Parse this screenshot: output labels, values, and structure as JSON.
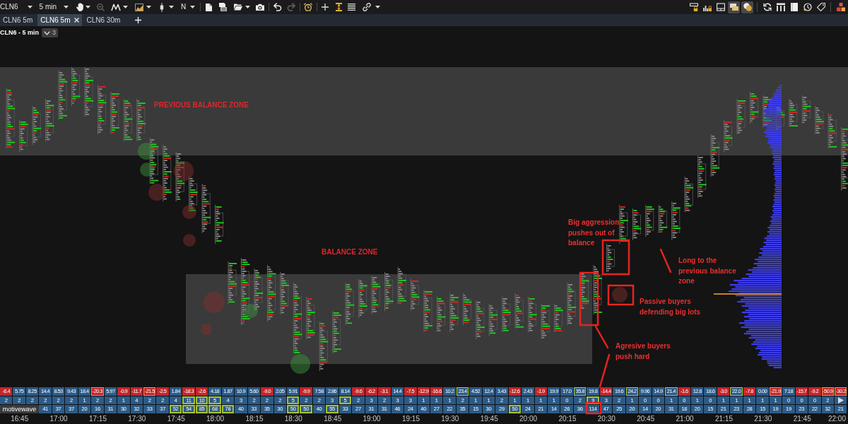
{
  "toolbar": {
    "symbol": "CLN6",
    "interval": "5 min",
    "text_tool": "N",
    "zoom_out": {
      "disabled": true
    },
    "redo": {
      "disabled": true
    },
    "right_buttons": [
      {
        "selected": false
      },
      {
        "selected": false
      },
      {
        "selected": false
      },
      {
        "selected": true
      },
      {
        "selected": true
      },
      {
        "selected": false
      },
      {
        "selected": false
      },
      {
        "selected": false
      },
      {
        "selected": false
      },
      {
        "selected": false
      },
      {
        "selected": false
      }
    ]
  },
  "tabs": [
    {
      "label": "CLN6 5m",
      "selected": false
    },
    {
      "label": "CLN6 5m",
      "selected": true
    },
    {
      "label": "CLN6 30m",
      "selected": false
    }
  ],
  "chart": {
    "title": "CLN6 - 5 min",
    "collapsed_count": "3",
    "zones": [
      {
        "label": "PREVIOUS BALANCE ZONE"
      },
      {
        "label": "BALANCE ZONE"
      }
    ],
    "notes": [
      {
        "text": "Big aggression pushes out of balance"
      },
      {
        "text": "Long to the previous balance zone"
      },
      {
        "text": "Passive buyers defending big lots"
      },
      {
        "text": "Agresive buyers push hard"
      }
    ]
  },
  "stats": {
    "badge": "motivewave",
    "rows": [
      {
        "cells": [
          {
            "text": "-6.4",
            "kind": "sell",
            "highlighted": false
          },
          {
            "text": "5.75",
            "kind": "buy",
            "highlighted": false
          },
          {
            "text": "8.25",
            "kind": "buy",
            "highlighted": false
          },
          {
            "text": "14.4",
            "kind": "buy",
            "highlighted": false
          },
          {
            "text": "8.53",
            "kind": "buy",
            "highlighted": false
          },
          {
            "text": "9.43",
            "kind": "buy",
            "highlighted": false
          },
          {
            "text": "18.4",
            "kind": "buy",
            "highlighted": false
          },
          {
            "text": "-20.3",
            "kind": "sell",
            "highlighted": true
          },
          {
            "text": "5.97",
            "kind": "buy",
            "highlighted": false
          },
          {
            "text": "-0.9",
            "kind": "sell",
            "highlighted": false
          },
          {
            "text": "-11.7",
            "kind": "sell",
            "highlighted": false
          },
          {
            "text": "-21.5",
            "kind": "sell",
            "highlighted": true
          },
          {
            "text": "-2.5",
            "kind": "sell",
            "highlighted": false
          },
          {
            "text": "1.84",
            "kind": "buy",
            "highlighted": false
          },
          {
            "text": "-18.3",
            "kind": "sell",
            "highlighted": false
          },
          {
            "text": "-2.6",
            "kind": "sell",
            "highlighted": false
          },
          {
            "text": "4.18",
            "kind": "buy",
            "highlighted": false
          },
          {
            "text": "1.87",
            "kind": "buy",
            "highlighted": false
          },
          {
            "text": "10.9",
            "kind": "buy",
            "highlighted": false
          },
          {
            "text": "5.60",
            "kind": "buy",
            "highlighted": false
          },
          {
            "text": "-9.0",
            "kind": "sell",
            "highlighted": false
          },
          {
            "text": "2.05",
            "kind": "buy",
            "highlighted": false
          },
          {
            "text": "5.91",
            "kind": "buy",
            "highlighted": false
          },
          {
            "text": "-9.9",
            "kind": "sell",
            "highlighted": false
          },
          {
            "text": "7.58",
            "kind": "buy",
            "highlighted": false
          },
          {
            "text": "2.86",
            "kind": "buy",
            "highlighted": false
          },
          {
            "text": "8.14",
            "kind": "buy",
            "highlighted": false
          },
          {
            "text": "-9.6",
            "kind": "sell",
            "highlighted": false
          },
          {
            "text": "-6.2",
            "kind": "sell",
            "highlighted": false
          },
          {
            "text": "-3.1",
            "kind": "sell",
            "highlighted": false
          },
          {
            "text": "14.4",
            "kind": "buy",
            "highlighted": false
          },
          {
            "text": "-7.5",
            "kind": "sell",
            "highlighted": false
          },
          {
            "text": "-12.9",
            "kind": "sell",
            "highlighted": false
          },
          {
            "text": "-16.6",
            "kind": "sell",
            "highlighted": false
          },
          {
            "text": "10.2",
            "kind": "buy",
            "highlighted": false
          },
          {
            "text": "23.4",
            "kind": "buy",
            "highlighted": true
          },
          {
            "text": "4.52",
            "kind": "buy",
            "highlighted": false
          },
          {
            "text": "12.4",
            "kind": "buy",
            "highlighted": false
          },
          {
            "text": "3.43",
            "kind": "buy",
            "highlighted": false
          },
          {
            "text": "-12.6",
            "kind": "sell",
            "highlighted": false
          },
          {
            "text": "2.43",
            "kind": "buy",
            "highlighted": false
          },
          {
            "text": "-1.9",
            "kind": "sell",
            "highlighted": false
          },
          {
            "text": "19.9",
            "kind": "buy",
            "highlighted": false
          },
          {
            "text": "17.0",
            "kind": "buy",
            "highlighted": false
          },
          {
            "text": "35.8",
            "kind": "buy",
            "highlighted": true
          },
          {
            "text": "19.8",
            "kind": "buy",
            "highlighted": false
          },
          {
            "text": "-14.4",
            "kind": "sell",
            "highlighted": false
          },
          {
            "text": "19.6",
            "kind": "buy",
            "highlighted": false
          },
          {
            "text": "24.2",
            "kind": "buy",
            "highlighted": true
          },
          {
            "text": "9.96",
            "kind": "buy",
            "highlighted": false
          },
          {
            "text": "14.9",
            "kind": "buy",
            "highlighted": false
          },
          {
            "text": "21.4",
            "kind": "buy",
            "highlighted": true
          },
          {
            "text": "-1.6",
            "kind": "sell",
            "highlighted": false
          },
          {
            "text": "12.8",
            "kind": "buy",
            "highlighted": false
          },
          {
            "text": "18.6",
            "kind": "buy",
            "highlighted": false
          },
          {
            "text": "-3.0",
            "kind": "sell",
            "highlighted": false
          },
          {
            "text": "22.0",
            "kind": "buy",
            "highlighted": true
          },
          {
            "text": "-7.8",
            "kind": "sell",
            "highlighted": false
          },
          {
            "text": "0.00",
            "kind": "buy",
            "highlighted": false
          },
          {
            "text": "-21.9",
            "kind": "sell",
            "highlighted": true
          },
          {
            "text": "7.18",
            "kind": "buy",
            "highlighted": false
          },
          {
            "text": "-15.7",
            "kind": "sell",
            "highlighted": false
          },
          {
            "text": "-9.2",
            "kind": "sell",
            "highlighted": false
          },
          {
            "text": "-50.9",
            "kind": "sell",
            "highlighted": true
          },
          {
            "text": "-30.2",
            "kind": "sell",
            "highlighted": true
          }
        ]
      },
      {
        "cells": [
          {
            "text": "2",
            "highlighted": false
          },
          {
            "text": "2",
            "highlighted": false
          },
          {
            "text": "2",
            "highlighted": false
          },
          {
            "text": "2",
            "highlighted": false
          },
          {
            "text": "2",
            "highlighted": false
          },
          {
            "text": "2",
            "highlighted": false
          },
          {
            "text": "1",
            "highlighted": false
          },
          {
            "text": "2",
            "highlighted": false
          },
          {
            "text": "2",
            "highlighted": false
          },
          {
            "text": "1",
            "highlighted": false
          },
          {
            "text": "4",
            "highlighted": false
          },
          {
            "text": "2",
            "highlighted": false
          },
          {
            "text": "2",
            "highlighted": false
          },
          {
            "text": "4",
            "highlighted": false
          },
          {
            "text": "11",
            "highlighted": true
          },
          {
            "text": "10",
            "highlighted": true
          },
          {
            "text": "5",
            "highlighted": true
          },
          {
            "text": "4",
            "highlighted": false
          },
          {
            "text": "3",
            "highlighted": false
          },
          {
            "text": "2",
            "highlighted": false
          },
          {
            "text": "2",
            "highlighted": false
          },
          {
            "text": "2",
            "highlighted": false
          },
          {
            "text": "5",
            "highlighted": true
          },
          {
            "text": "2",
            "highlighted": false
          },
          {
            "text": "2",
            "highlighted": false
          },
          {
            "text": "3",
            "highlighted": false
          },
          {
            "text": "5",
            "highlighted": true
          },
          {
            "text": "2",
            "highlighted": false
          },
          {
            "text": "3",
            "highlighted": false
          },
          {
            "text": "2",
            "highlighted": false
          },
          {
            "text": "3",
            "highlighted": false
          },
          {
            "text": "3",
            "highlighted": false
          },
          {
            "text": "1",
            "highlighted": false
          },
          {
            "text": "1",
            "highlighted": false
          },
          {
            "text": "1",
            "highlighted": false
          },
          {
            "text": "2",
            "highlighted": false
          },
          {
            "text": "1",
            "highlighted": false
          },
          {
            "text": "1",
            "highlighted": false
          },
          {
            "text": "2",
            "highlighted": false
          },
          {
            "text": "1",
            "highlighted": false
          },
          {
            "text": "1",
            "highlighted": false
          },
          {
            "text": "1",
            "highlighted": false
          },
          {
            "text": "1",
            "highlighted": false
          },
          {
            "text": "0",
            "highlighted": false
          },
          {
            "text": "2",
            "highlighted": false
          },
          {
            "text": "9",
            "highlighted": true
          },
          {
            "text": "3",
            "highlighted": false
          },
          {
            "text": "2",
            "highlighted": false
          },
          {
            "text": "1",
            "highlighted": false
          },
          {
            "text": "0",
            "highlighted": false
          },
          {
            "text": "0",
            "highlighted": false
          },
          {
            "text": "1",
            "highlighted": false
          },
          {
            "text": "0",
            "highlighted": false
          },
          {
            "text": "1",
            "highlighted": false
          },
          {
            "text": "0",
            "highlighted": false
          },
          {
            "text": "1",
            "highlighted": false
          },
          {
            "text": "1",
            "highlighted": false
          },
          {
            "text": "1",
            "highlighted": false
          },
          {
            "text": "1",
            "highlighted": false
          },
          {
            "text": "1",
            "highlighted": false
          },
          {
            "text": "0",
            "highlighted": false
          },
          {
            "text": "0",
            "highlighted": false
          },
          {
            "text": "0",
            "highlighted": false
          },
          {
            "text": "2",
            "highlighted": false
          },
          {
            "text": "",
            "kind": "arrow",
            "highlighted": false
          }
        ]
      },
      {
        "cells": [
          {
            "text": ""
          },
          {
            "text": ""
          },
          {
            "text": ""
          },
          {
            "text": "41",
            "highlighted": false
          },
          {
            "text": "37",
            "highlighted": false
          },
          {
            "text": "37",
            "highlighted": false
          },
          {
            "text": "20",
            "highlighted": false
          },
          {
            "text": "16",
            "highlighted": false
          },
          {
            "text": "31",
            "highlighted": false
          },
          {
            "text": "30",
            "highlighted": false
          },
          {
            "text": "32",
            "highlighted": false
          },
          {
            "text": "33",
            "highlighted": false
          },
          {
            "text": "37",
            "highlighted": false
          },
          {
            "text": "52",
            "highlighted": true
          },
          {
            "text": "54",
            "highlighted": true
          },
          {
            "text": "85",
            "highlighted": true
          },
          {
            "text": "68",
            "highlighted": true
          },
          {
            "text": "78",
            "highlighted": true
          },
          {
            "text": "40",
            "highlighted": false
          },
          {
            "text": "33",
            "highlighted": false
          },
          {
            "text": "35",
            "highlighted": false
          },
          {
            "text": "30",
            "highlighted": false
          },
          {
            "text": "50",
            "highlighted": true
          },
          {
            "text": "50",
            "highlighted": true
          },
          {
            "text": "40",
            "highlighted": false
          },
          {
            "text": "55",
            "highlighted": true
          },
          {
            "text": "33",
            "highlighted": false
          },
          {
            "text": "27",
            "highlighted": false
          },
          {
            "text": "31",
            "highlighted": false
          },
          {
            "text": "31",
            "highlighted": false
          },
          {
            "text": "46",
            "highlighted": false
          },
          {
            "text": "24",
            "highlighted": false
          },
          {
            "text": "40",
            "highlighted": false
          },
          {
            "text": "27",
            "highlighted": false
          },
          {
            "text": "22",
            "highlighted": false
          },
          {
            "text": "35",
            "highlighted": false
          },
          {
            "text": "15",
            "highlighted": false
          },
          {
            "text": "30",
            "highlighted": false
          },
          {
            "text": "29",
            "highlighted": false
          },
          {
            "text": "50",
            "highlighted": true
          },
          {
            "text": "24",
            "highlighted": false
          },
          {
            "text": "21",
            "highlighted": false
          },
          {
            "text": "14",
            "highlighted": false
          },
          {
            "text": "26",
            "highlighted": false
          },
          {
            "text": "36",
            "highlighted": false
          },
          {
            "text": "114",
            "highlighted": false
          },
          {
            "text": "47",
            "highlighted": false
          },
          {
            "text": "25",
            "highlighted": false
          },
          {
            "text": "20",
            "highlighted": false
          },
          {
            "text": "14",
            "highlighted": false
          },
          {
            "text": "20",
            "highlighted": false
          },
          {
            "text": "31",
            "highlighted": false
          },
          {
            "text": "18",
            "highlighted": false
          },
          {
            "text": "20",
            "highlighted": false
          },
          {
            "text": "15",
            "highlighted": false
          },
          {
            "text": "21",
            "highlighted": false
          },
          {
            "text": "23",
            "highlighted": false
          },
          {
            "text": "28",
            "highlighted": false
          },
          {
            "text": "15",
            "highlighted": false
          },
          {
            "text": "19",
            "highlighted": false
          },
          {
            "text": "19",
            "highlighted": false
          },
          {
            "text": "23",
            "highlighted": false
          },
          {
            "text": "22",
            "highlighted": false
          },
          {
            "text": "32",
            "highlighted": false
          },
          {
            "text": "21",
            "highlighted": false
          }
        ]
      }
    ]
  },
  "time_axis": {
    "labels": [
      "16:45",
      "17:00",
      "17:15",
      "17:30",
      "17:45",
      "18:00",
      "18:15",
      "18:30",
      "18:45",
      "19:00",
      "19:15",
      "19:30",
      "19:45",
      "20:00",
      "20:15",
      "20:30",
      "20:45",
      "21:00",
      "21:15",
      "21:30",
      "21:45",
      "22:00"
    ]
  }
}
